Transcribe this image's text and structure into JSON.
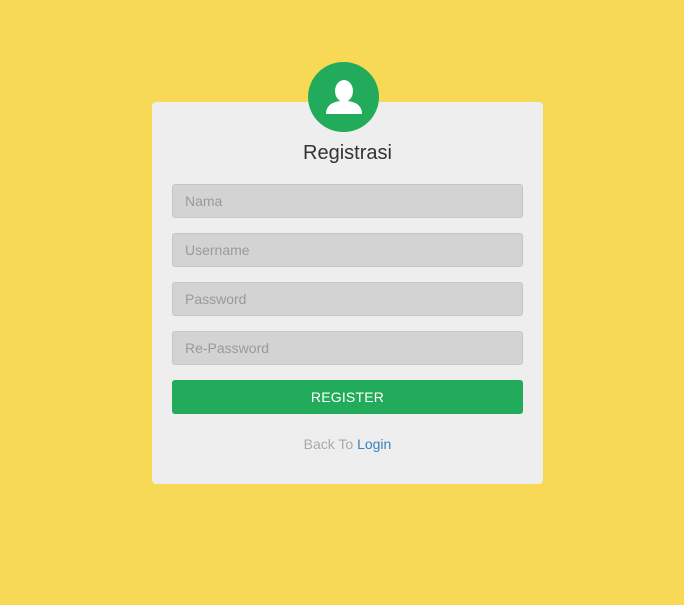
{
  "form": {
    "title": "Registrasi",
    "fields": [
      {
        "placeholder": "Nama",
        "value": ""
      },
      {
        "placeholder": "Username",
        "value": ""
      },
      {
        "placeholder": "Password",
        "value": ""
      },
      {
        "placeholder": "Re-Password",
        "value": ""
      }
    ],
    "submit_label": "REGISTER",
    "footer_text": "Back To",
    "footer_link": "Login"
  },
  "avatar": {
    "icon": "user-icon"
  },
  "colors": {
    "background": "#f8d955",
    "card": "#eeeeee",
    "accent": "#22ab5a",
    "link": "#3a7fc2"
  }
}
